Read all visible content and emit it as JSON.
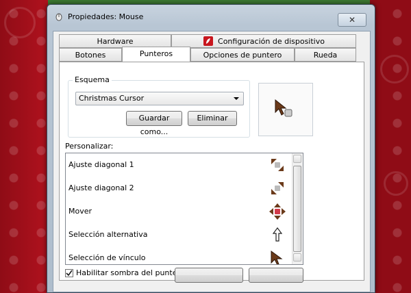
{
  "window": {
    "title": "Propiedades: Mouse",
    "close_glyph": "✕"
  },
  "tabs": {
    "row1": [
      {
        "label": "Hardware"
      },
      {
        "label": "Configuración de dispositivo",
        "icon": "device-settings-icon"
      }
    ],
    "row2": [
      {
        "label": "Botones"
      },
      {
        "label": "Punteros",
        "active": true
      },
      {
        "label": "Opciones de puntero"
      },
      {
        "label": "Rueda"
      }
    ]
  },
  "scheme": {
    "legend": "Esquema",
    "selected": "Christmas Cursor",
    "save_as_label": "Guardar como...",
    "delete_label": "Eliminar"
  },
  "customize": {
    "label": "Personalizar:",
    "items": [
      {
        "label": "Ajuste diagonal 1",
        "icon": "diagonal-resize-1-cursor-icon"
      },
      {
        "label": "Ajuste diagonal 2",
        "icon": "diagonal-resize-2-cursor-icon"
      },
      {
        "label": "Mover",
        "icon": "move-cursor-icon"
      },
      {
        "label": "Selección alternativa",
        "icon": "alternate-select-cursor-icon"
      },
      {
        "label": "Selección de vínculo",
        "icon": "link-select-cursor-icon"
      }
    ]
  },
  "shadow": {
    "label": "Habilitar sombra del puntero",
    "checked": true
  },
  "colors": {
    "accent": "#5a2a0e",
    "cursor_fill": "#6b3a1a"
  }
}
